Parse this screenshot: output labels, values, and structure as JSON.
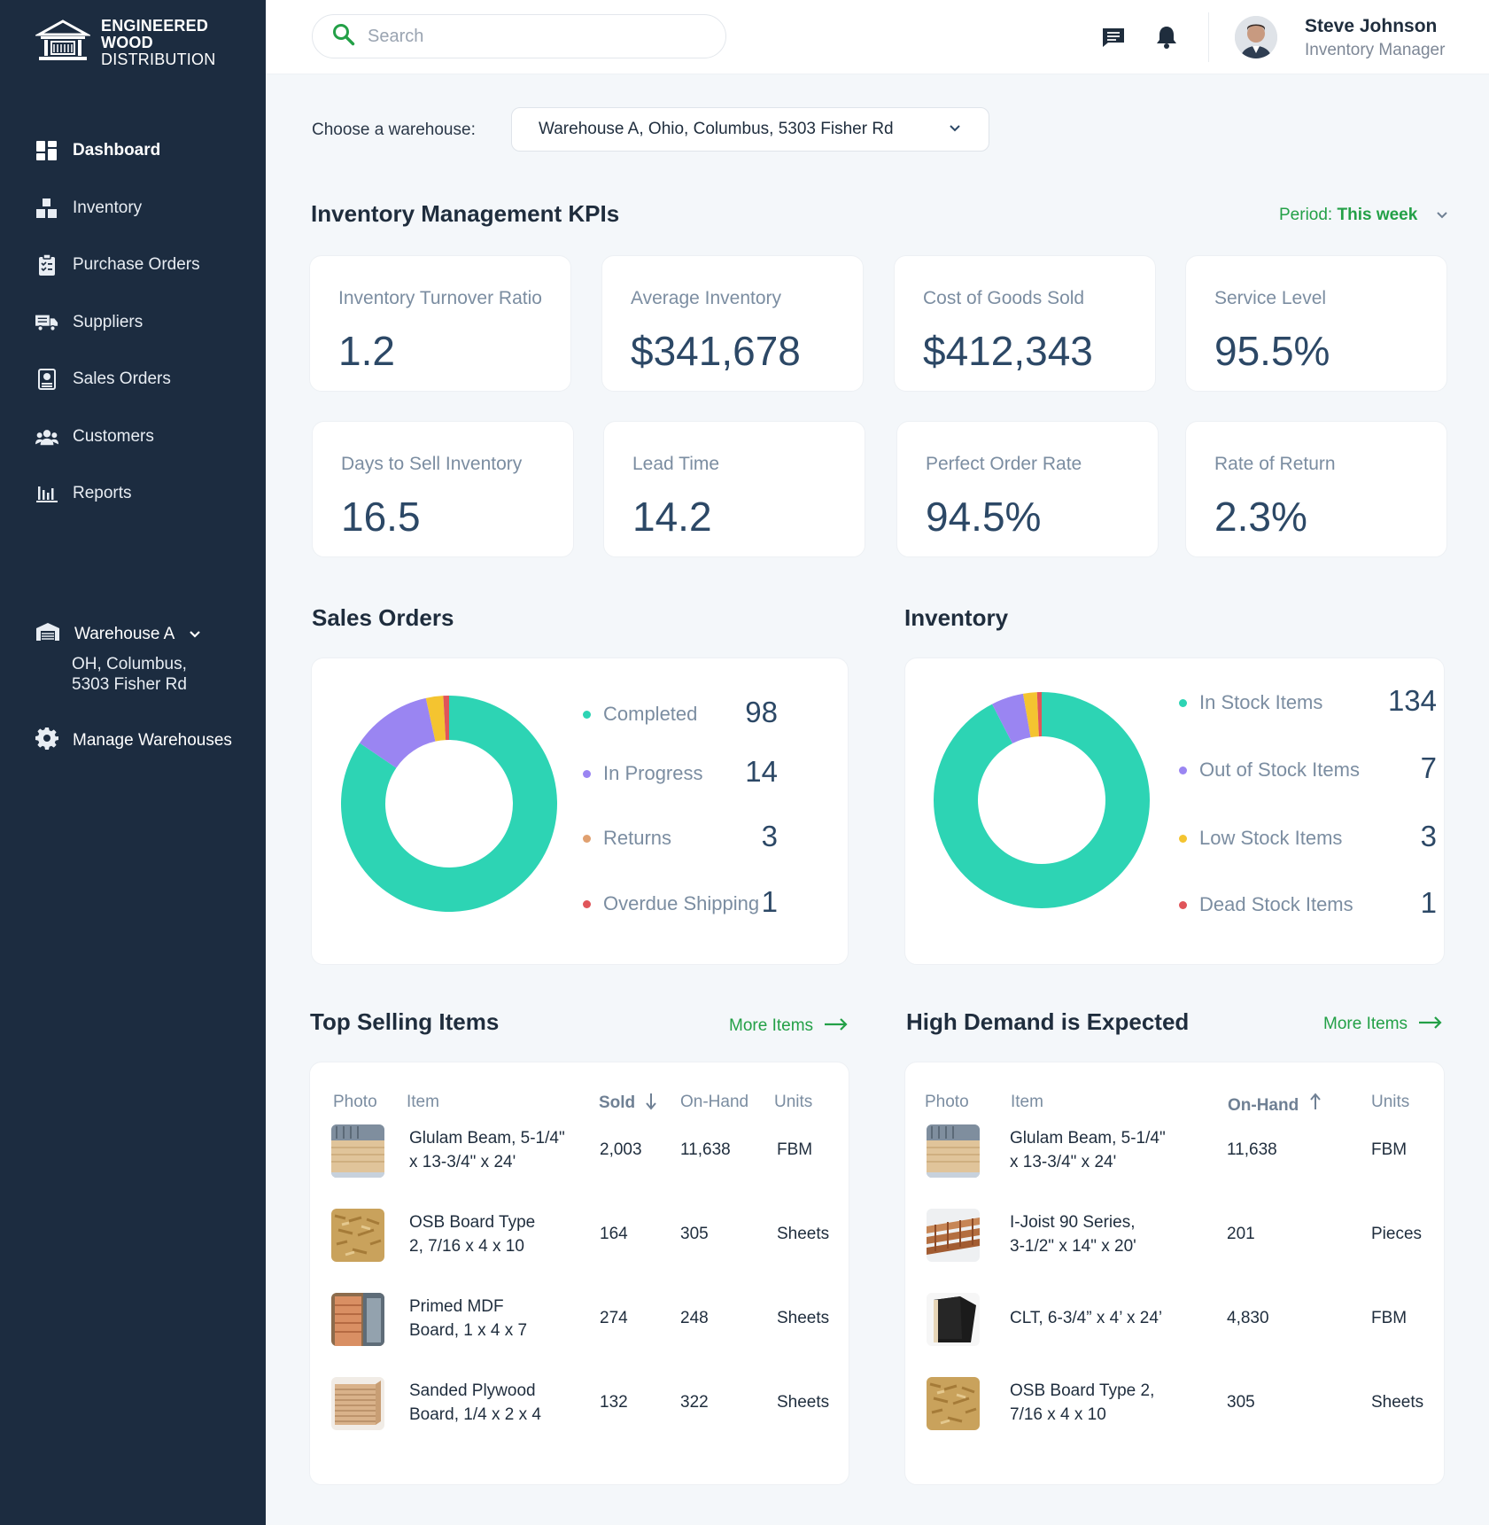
{
  "brand": {
    "line1": "ENGINEERED",
    "line2": "WOOD",
    "line3": "DISTRIBUTION"
  },
  "nav": [
    {
      "label": "Dashboard",
      "icon": "dashboard-icon",
      "active": true
    },
    {
      "label": "Inventory",
      "icon": "boxes-icon"
    },
    {
      "label": "Purchase Orders",
      "icon": "clipboard-icon"
    },
    {
      "label": "Suppliers",
      "icon": "truck-icon"
    },
    {
      "label": "Sales Orders",
      "icon": "receipt-icon"
    },
    {
      "label": "Customers",
      "icon": "users-icon"
    },
    {
      "label": "Reports",
      "icon": "bar-chart-icon"
    }
  ],
  "sidebar_warehouse": {
    "name": "Warehouse A",
    "addr1": "OH, Columbus,",
    "addr2": "5303 Fisher Rd"
  },
  "manage_label": "Manage Warehouses",
  "search": {
    "placeholder": "Search"
  },
  "user": {
    "name": "Steve Johnson",
    "role": "Inventory Manager"
  },
  "chooser": {
    "label": "Choose a warehouse:",
    "value": "Warehouse A, Ohio, Columbus, 5303 Fisher Rd"
  },
  "kpis": {
    "title": "Inventory Management KPIs",
    "period_label": "Period:",
    "period_value": "This week",
    "cards": [
      {
        "label": "Inventory Turnover Ratio",
        "value": "1.2"
      },
      {
        "label": "Average Inventory",
        "value": "$341,678"
      },
      {
        "label": "Cost of Goods Sold",
        "value": "$412,343"
      },
      {
        "label": "Service Level",
        "value": "95.5%"
      },
      {
        "label": "Days to Sell Inventory",
        "value": "16.5"
      },
      {
        "label": "Lead Time",
        "value": "14.2"
      },
      {
        "label": "Perfect Order Rate",
        "value": "94.5%"
      },
      {
        "label": "Rate of Return",
        "value": "2.3%"
      }
    ]
  },
  "colors": {
    "teal": "#2dd4b4",
    "purple": "#9a85f2",
    "orange": "#e0a070",
    "yellow": "#f4c430",
    "red": "#e0555a",
    "green": "#23a047",
    "sidebar": "#1c2c40"
  },
  "chart_data": [
    {
      "type": "pie",
      "title": "Sales Orders",
      "categories": [
        "Completed",
        "In Progress",
        "Returns",
        "Overdue Shipping"
      ],
      "values": [
        98,
        14,
        3,
        1
      ],
      "colors": [
        "#2dd4b4",
        "#9a85f2",
        "#f4c430",
        "#e0555a"
      ],
      "dot_colors": [
        "#2dd4b4",
        "#9a85f2",
        "#e0a070",
        "#e0555a"
      ]
    },
    {
      "type": "pie",
      "title": "Inventory",
      "categories": [
        "In Stock Items",
        "Out of Stock Items",
        "Low Stock Items",
        "Dead Stock Items"
      ],
      "values": [
        134,
        7,
        3,
        1
      ],
      "colors": [
        "#2dd4b4",
        "#9a85f2",
        "#f4c430",
        "#e0555a"
      ],
      "dot_colors": [
        "#2dd4b4",
        "#9a85f2",
        "#f4c430",
        "#e0555a"
      ]
    }
  ],
  "top_selling": {
    "title": "Top Selling Items",
    "more": "More Items",
    "headers": {
      "photo": "Photo",
      "item": "Item",
      "sold": "Sold",
      "onhand": "On-Hand",
      "units": "Units"
    },
    "rows": [
      {
        "line1": "Glulam Beam, 5-1/4\"",
        "line2": "x 13-3/4\" x 24'",
        "sold": "2,003",
        "onhand": "11,638",
        "units": "FBM",
        "photo": "glulam"
      },
      {
        "line1": "OSB Board Type",
        "line2": "2, 7/16 x 4 x 10",
        "sold": "164",
        "onhand": "305",
        "units": "Sheets",
        "photo": "osb"
      },
      {
        "line1": "Primed MDF",
        "line2": "Board, 1 x 4 x 7",
        "sold": "274",
        "onhand": "248",
        "units": "Sheets",
        "photo": "mdf"
      },
      {
        "line1": "Sanded Plywood",
        "line2": "Board, 1/4 x 2 x 4",
        "sold": "132",
        "onhand": "322",
        "units": "Sheets",
        "photo": "plywood"
      }
    ]
  },
  "high_demand": {
    "title": "High Demand is Expected",
    "more": "More Items",
    "headers": {
      "photo": "Photo",
      "item": "Item",
      "onhand": "On-Hand",
      "units": "Units"
    },
    "rows": [
      {
        "line1": "Glulam Beam, 5-1/4\"",
        "line2": "x 13-3/4\" x 24'",
        "onhand": "11,638",
        "units": "FBM",
        "photo": "glulam"
      },
      {
        "line1": "I-Joist 90 Series,",
        "line2": "3-1/2\" x 14\" x 20'",
        "onhand": "201",
        "units": "Pieces",
        "photo": "ijoist"
      },
      {
        "line1": "CLT, 6-3/4” x 4’ x 24’",
        "line2": "",
        "onhand": "4,830",
        "units": "FBM",
        "photo": "clt"
      },
      {
        "line1": "OSB Board Type 2,",
        "line2": "7/16 x 4 x 10",
        "onhand": "305",
        "units": "Sheets",
        "photo": "osb"
      }
    ]
  }
}
